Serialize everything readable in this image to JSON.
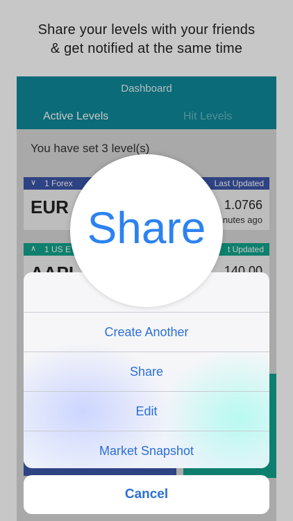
{
  "caption": {
    "line1": "Share your levels with your friends",
    "line2": "& get notified at the same time"
  },
  "app": {
    "title": "Dashboard",
    "tabs": [
      {
        "label": "Active Levels",
        "active": true
      },
      {
        "label": "Hit Levels",
        "active": false
      }
    ],
    "levels_text": "You have set 3 level(s)",
    "cards": [
      {
        "category": "1 Forex",
        "updated": "Last Updated",
        "symbol": "EUR",
        "price": "1.0766",
        "ago": "nutes ago",
        "color": "#3b57a8"
      },
      {
        "category": "1 US E",
        "updated": "t Updated",
        "symbol": "AAPL",
        "price": "140.00",
        "color": "#12a48c"
      }
    ]
  },
  "action_sheet": {
    "options": [
      "Create Another",
      "Share",
      "Edit",
      "Market Snapshot"
    ],
    "cancel_label": "Cancel"
  },
  "magnifier": {
    "text": "Share"
  },
  "colors": {
    "header": "#0f8a9a",
    "accent_blue": "#2c6fd6",
    "forex": "#3b57a8",
    "stocks": "#12a48c"
  }
}
